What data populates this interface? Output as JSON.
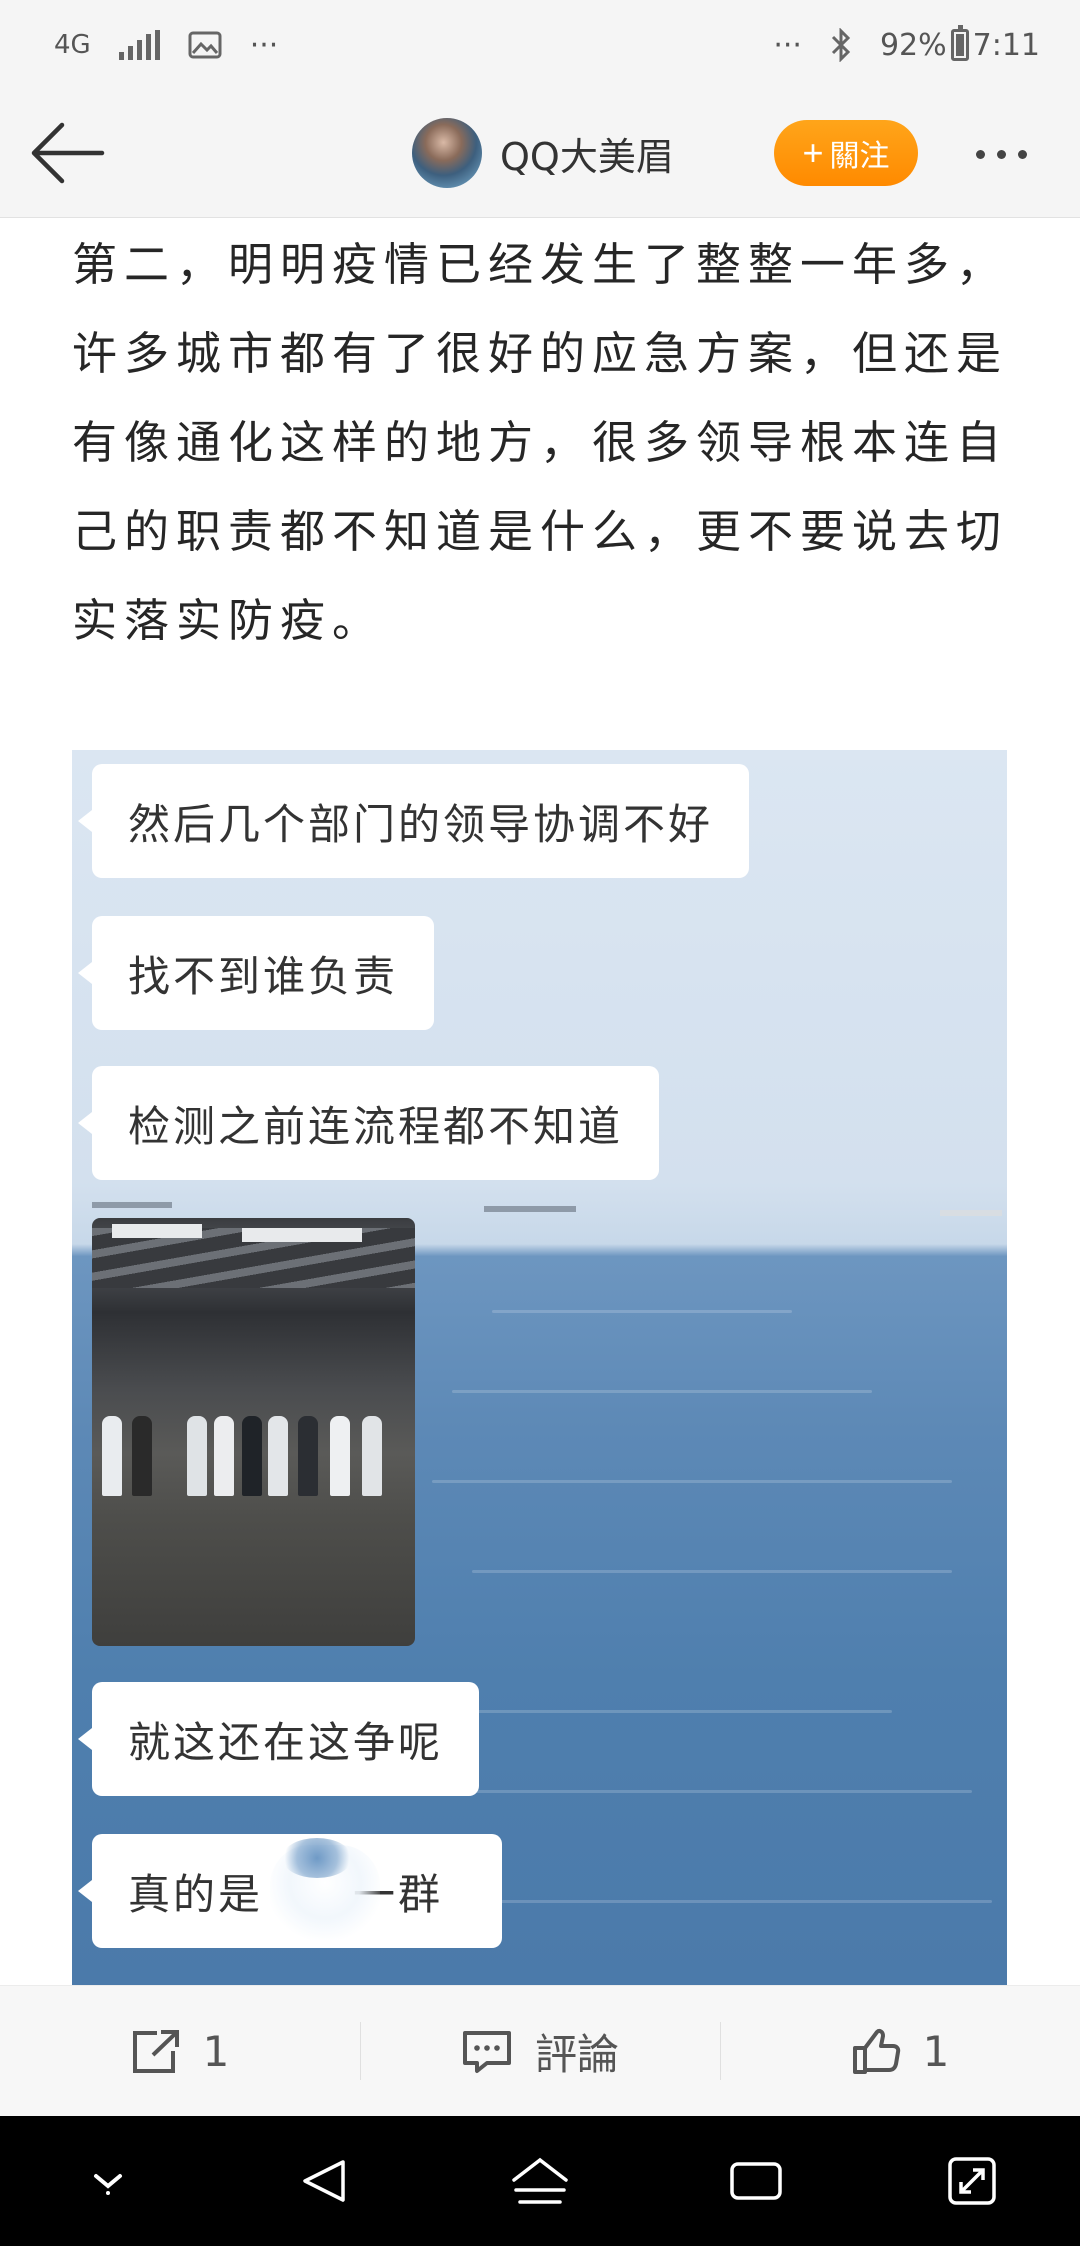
{
  "status_bar": {
    "network": "4G",
    "overflow": "···",
    "overflow_right": "···",
    "battery": "92%",
    "time": "7:11"
  },
  "nav": {
    "author_name": "QQ大美眉",
    "follow_label": "關注"
  },
  "article": {
    "text": "第二，明明疫情已经发生了整整一年多，许多城市都有了很好的应急方案，但还是有像通化这样的地方，很多领导根本连自己的职责都不知道是什么，更不要说去切实落实防疫。"
  },
  "chat": {
    "messages": [
      "然后几个部门的领导协调不好",
      "找不到谁负责",
      "检测之前连流程都不知道",
      "就这还在这争呢",
      "真的是",
      "一群"
    ]
  },
  "actions": {
    "share_count": "1",
    "comment_label": "評論",
    "like_count": "1"
  },
  "colors": {
    "follow": "#ff9500",
    "sea": "#5d89b6",
    "sky": "#d6e2ef"
  },
  "icons": [
    "back-arrow-icon",
    "more-dots-icon",
    "share-icon",
    "comment-icon",
    "like-icon",
    "bluetooth-icon",
    "image-icon"
  ]
}
